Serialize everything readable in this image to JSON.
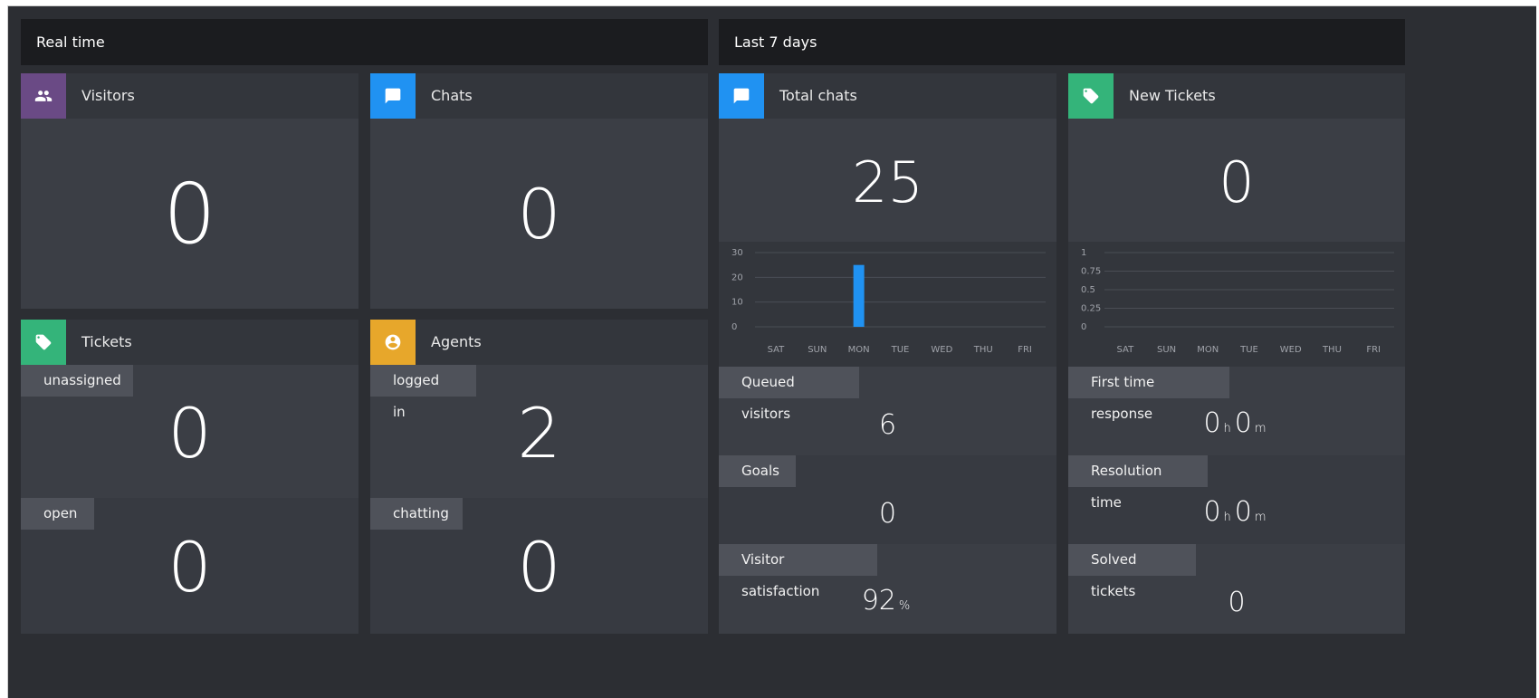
{
  "sections": {
    "realtime_title": "Real time",
    "last7_title": "Last 7 days"
  },
  "colors": {
    "purple": "#6a4a85",
    "blue": "#2092f2",
    "green": "#34b47a",
    "orange": "#e7a72b"
  },
  "realtime": {
    "visitors": {
      "title": "Visitors",
      "value": "0",
      "icon": "users-icon"
    },
    "chats": {
      "title": "Chats",
      "value": "0",
      "icon": "chat-icon"
    },
    "tickets": {
      "title": "Tickets",
      "icon": "tag-icon",
      "unassigned_label": "unassigned",
      "unassigned_value": "0",
      "open_label": "open",
      "open_value": "0"
    },
    "agents": {
      "title": "Agents",
      "icon": "agent-icon",
      "logged_in_label": "logged in",
      "logged_in_value": "2",
      "chatting_label": "chatting",
      "chatting_value": "0"
    }
  },
  "last7": {
    "total_chats": {
      "title": "Total chats",
      "value": "25",
      "icon": "chat-icon",
      "queued_label": "Queued visitors",
      "queued_value": "6",
      "goals_label": "Goals",
      "goals_value": "0",
      "satisfaction_label": "Visitor satisfaction",
      "satisfaction_value": "92",
      "satisfaction_unit": "%"
    },
    "new_tickets": {
      "title": "New Tickets",
      "value": "0",
      "icon": "tag-icon",
      "first_response_label": "First time response",
      "first_response_h": "0",
      "first_response_m": "0",
      "resolution_label": "Resolution time",
      "resolution_h": "0",
      "resolution_m": "0",
      "solved_label": "Solved tickets",
      "solved_value": "0",
      "hour_unit": "h",
      "minute_unit": "m"
    }
  },
  "chart_data": [
    {
      "type": "bar",
      "categories": [
        "SAT",
        "SUN",
        "MON",
        "TUE",
        "WED",
        "THU",
        "FRI"
      ],
      "values": [
        0,
        0,
        25,
        0,
        0,
        0,
        0
      ],
      "yticks": [
        "0",
        "10",
        "20",
        "30"
      ],
      "ylim": [
        0,
        30
      ],
      "color": "#2092f2"
    },
    {
      "type": "bar",
      "categories": [
        "SAT",
        "SUN",
        "MON",
        "TUE",
        "WED",
        "THU",
        "FRI"
      ],
      "values": [
        0,
        0,
        0,
        0,
        0,
        0,
        0
      ],
      "yticks": [
        "0",
        "0.25",
        "0.5",
        "0.75",
        "1"
      ],
      "ylim": [
        0,
        1
      ],
      "color": "#2092f2"
    }
  ]
}
